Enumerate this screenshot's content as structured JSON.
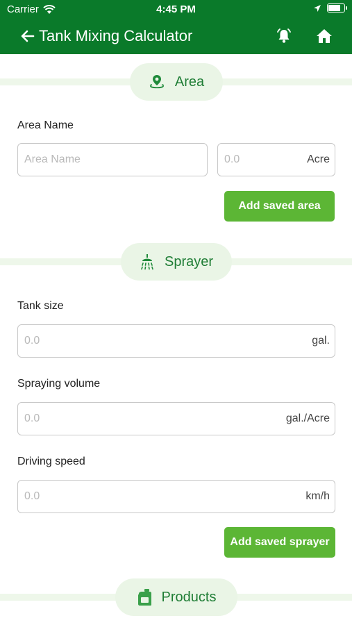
{
  "status": {
    "carrier": "Carrier",
    "time": "4:45 PM"
  },
  "header": {
    "title": "Tank Mixing Calculator",
    "back_icon": "arrow-left-icon",
    "notification_icon": "bell-ring-icon",
    "home_icon": "home-icon",
    "background": "#0a7a2a"
  },
  "area": {
    "section_title": "Area",
    "section_icon": "map-pin-icon",
    "name_label": "Area Name",
    "name_placeholder": "Area Name",
    "size_placeholder": "0.0",
    "size_unit": "Acre",
    "add_button": "Add saved area"
  },
  "sprayer": {
    "section_title": "Sprayer",
    "section_icon": "shower-icon",
    "tank_size_label": "Tank size",
    "tank_size_placeholder": "0.0",
    "tank_size_unit": "gal.",
    "volume_label": "Spraying volume",
    "volume_placeholder": "0.0",
    "volume_unit": "gal./Acre",
    "speed_label": "Driving speed",
    "speed_placeholder": "0.0",
    "speed_unit": "km/h",
    "add_button": "Add saved sprayer"
  },
  "products": {
    "section_title": "Products",
    "section_icon": "jerrycan-icon"
  },
  "colors": {
    "accent": "#5cb635",
    "section_text": "#1f7d35",
    "section_bg": "#eaf5e6"
  }
}
